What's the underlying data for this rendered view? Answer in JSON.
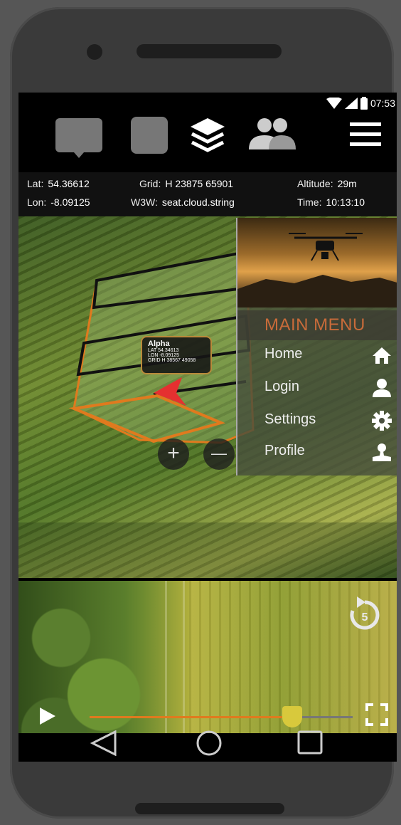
{
  "status": {
    "time": "07:53"
  },
  "coords": {
    "lat_label": "Lat:",
    "lat_value": "54.36612",
    "lon_label": "Lon:",
    "lon_value": "-8.09125",
    "grid_label": "Grid:",
    "grid_value": "H 23875 65901",
    "w3w_label": "W3W:",
    "w3w_value": "seat.cloud.string",
    "alt_label": "Altitude:",
    "alt_value": "29m",
    "time_label": "Time:",
    "time_value": "10:13:10"
  },
  "map": {
    "marker_name": "Alpha",
    "marker_lat": "LAT 54.34613",
    "marker_lon": "LON -8.09125",
    "marker_grid": "GRID H 38567 49058",
    "zoom_in": "+",
    "zoom_out": "—"
  },
  "menu": {
    "title": "MAIN MENU",
    "items": [
      {
        "label": "Home",
        "icon": "home-icon"
      },
      {
        "label": "Login",
        "icon": "user-icon"
      },
      {
        "label": "Settings",
        "icon": "gear-icon"
      },
      {
        "label": "Profile",
        "icon": "profile-icon"
      }
    ]
  },
  "video": {
    "progress": 0.77
  },
  "colors": {
    "accent": "#c86b3a",
    "boundary": "#e07a1e",
    "arrow": "#e53030",
    "slider_thumb": "#d8c93c"
  }
}
